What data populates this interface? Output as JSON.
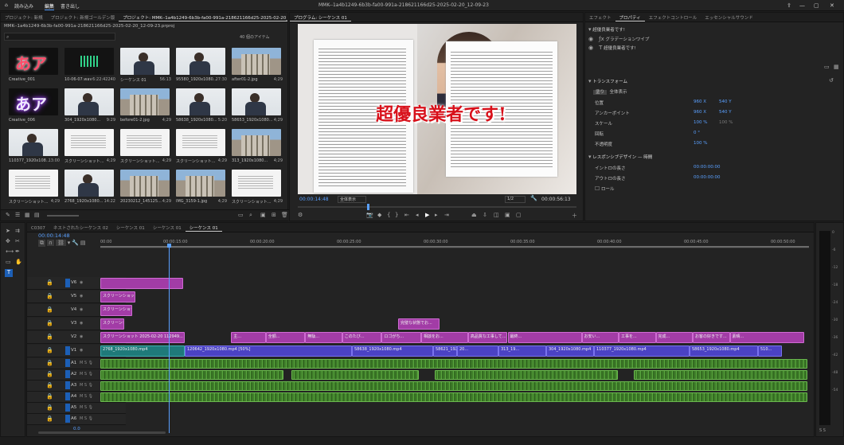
{
  "menu": {
    "items": [
      "読み込み",
      "編集",
      "書き出し"
    ],
    "active": "編集"
  },
  "window": {
    "title": "MMK--1a4b1249-6b3b-fa00-991a-218621166d25-2025-02-20_12-09-23"
  },
  "project_panel": {
    "tabs": [
      "プロジェクト: 新規",
      "プロジェクト: 新規ゴールデン版",
      "プロジェクト: MMK--1a4b1249-6b3b-fa00-991a-218621166d25-2025-02-20_12-09-23"
    ],
    "path": "MMK--1a4b1249-6b3b-fa00-991a-218621166d25-2025-02-20_12-09-23.prproj",
    "item_count": "40 個のアイテム",
    "items": [
      {
        "name": "Creative_001",
        "dur": "",
        "kind": "pink"
      },
      {
        "name": "10-06-07.wav",
        "dur": "6:22:42240",
        "kind": "wave"
      },
      {
        "name": "シーケンス 01",
        "dur": "56:13",
        "kind": "person"
      },
      {
        "name": "95580_1920x1080...",
        "dur": "27:30",
        "kind": "person"
      },
      {
        "name": "after01-2.jpg",
        "dur": "4;29",
        "kind": "house"
      },
      {
        "name": "Creative_006",
        "dur": "",
        "kind": "purpleglow"
      },
      {
        "name": "304_1920x1080...",
        "dur": "9:29",
        "kind": "person"
      },
      {
        "name": "before01-2.jpg",
        "dur": "4;29",
        "kind": "house"
      },
      {
        "name": "58638_1920x1080...",
        "dur": "5:20",
        "kind": "person"
      },
      {
        "name": "58653_1920x1080...",
        "dur": "4;29",
        "kind": "person"
      },
      {
        "name": "110377_1920x108...",
        "dur": "13:00",
        "kind": "person"
      },
      {
        "name": "スクリーンショット...",
        "dur": "4;29",
        "kind": "doc"
      },
      {
        "name": "スクリーンショット...",
        "dur": "4;29",
        "kind": "doc"
      },
      {
        "name": "スクリーンショット...",
        "dur": "4;29",
        "kind": "doc"
      },
      {
        "name": "313_1920x1080...",
        "dur": "4;29",
        "kind": "house"
      },
      {
        "name": "スクリーンショット...",
        "dur": "4;29",
        "kind": "doc"
      },
      {
        "name": "2768_1920x1080...",
        "dur": "14:22",
        "kind": "person"
      },
      {
        "name": "20230212_145125...",
        "dur": "4;29",
        "kind": "house"
      },
      {
        "name": "IMG_3159-1.jpg",
        "dur": "4;29",
        "kind": "house"
      },
      {
        "name": "スクリーンショット...",
        "dur": "4;29",
        "kind": "doc"
      }
    ]
  },
  "program_monitor": {
    "tab": "プログラム: シーケンス 01",
    "title_text": "超優良業者です!",
    "timecode": "00:00:14:48",
    "fit": "全体表示",
    "quality": "1/2",
    "duration": "00:00:56:13"
  },
  "right_panel": {
    "tabs": [
      "エフェクト",
      "プロパティ",
      "エフェクトコントロール",
      "エッセンシャルサウンド"
    ],
    "active_tab": "プロパティ",
    "clip_name": "超優良業者です!",
    "layers": [
      "グラデーションワイプ",
      "超優良業者です!"
    ],
    "section_transform": "トランスフォーム",
    "opacity_label": "塗り",
    "fit_label": "全体表示",
    "position": {
      "label": "位置",
      "x": "960 X",
      "y": "540 Y"
    },
    "anchor": {
      "label": "アンカーポイント",
      "x": "960 X",
      "y": "540 Y"
    },
    "scale": {
      "label": "スケール",
      "value": "100 %",
      "secondary": "100 %"
    },
    "rotation": {
      "label": "回転",
      "value": "0 °"
    },
    "opacity": {
      "label": "不透明度",
      "value": "100 %"
    },
    "section_responsive": "レスポンシブデザイン — 時間",
    "in_label": "イントロの長さ",
    "in_value": "00:00:00:00",
    "out_label": "アウトロの長さ",
    "out_value": "00:00:00:00",
    "roll_label": "ロール"
  },
  "timeline": {
    "tabs": [
      "C0307",
      "ネストされたシーケンス 02",
      "シーケンス 01",
      "シーケンス 01",
      "シーケンス 01"
    ],
    "active_tab": "シーケンス 01",
    "timecode": "00:00:14:48",
    "ruler": [
      "00:00",
      "00:00:15:00",
      "00:00:20:00",
      "00:00:25:00",
      "00:00:30:00",
      "00:00:35:00",
      "00:00:40:00",
      "00:00:45:00",
      "00:00:50:00"
    ],
    "video_tracks": [
      "V6",
      "V5",
      "V4",
      "V3",
      "V2",
      "V1"
    ],
    "audio_tracks": [
      "A1",
      "A2",
      "A3",
      "A4",
      "A5",
      "A6"
    ],
    "audio_master": "0.0",
    "clips": {
      "v5": "スクリーンショット 2025-02-20 1129...",
      "v4": "スクリーンショット 2025-02-20 112909...",
      "v3": "スクリーンショット 2025-02-20 112859...",
      "v2": "スクリーンショット 2025-02-20 112949...",
      "v2_mid": "完璧な状態でお...",
      "v2_labels": [
        "主...",
        "全額...",
        "無駄...",
        "このたび...",
        "ロゴがち...",
        "相談をお...",
        "高品質な工事して...",
        "最終...",
        "お安い...",
        "工事を...",
        "完成...",
        "お客の好きです...",
        "素晴..."
      ],
      "v1": [
        "2768_1920x1080.mp4",
        "120642_1920x1080.mp4 [50%]",
        "58638_1920x1080.mp4",
        "58621_1920...",
        "20...",
        "313_19...",
        "304_1920x1080.mp4",
        "110377_1920x1080.mp4",
        "58653_1920x1080.mp4",
        "510..."
      ]
    }
  },
  "meter": {
    "scale": [
      "0",
      "-6",
      "-12",
      "-18",
      "-24",
      "-30",
      "-36",
      "-42",
      "-48",
      "-54"
    ],
    "bottom": "S S"
  },
  "colors": {
    "accent": "#5aa0ff",
    "purple": "#a23ca6",
    "blue_clip": "#4b42c4",
    "audio": "#3f7d2a"
  }
}
